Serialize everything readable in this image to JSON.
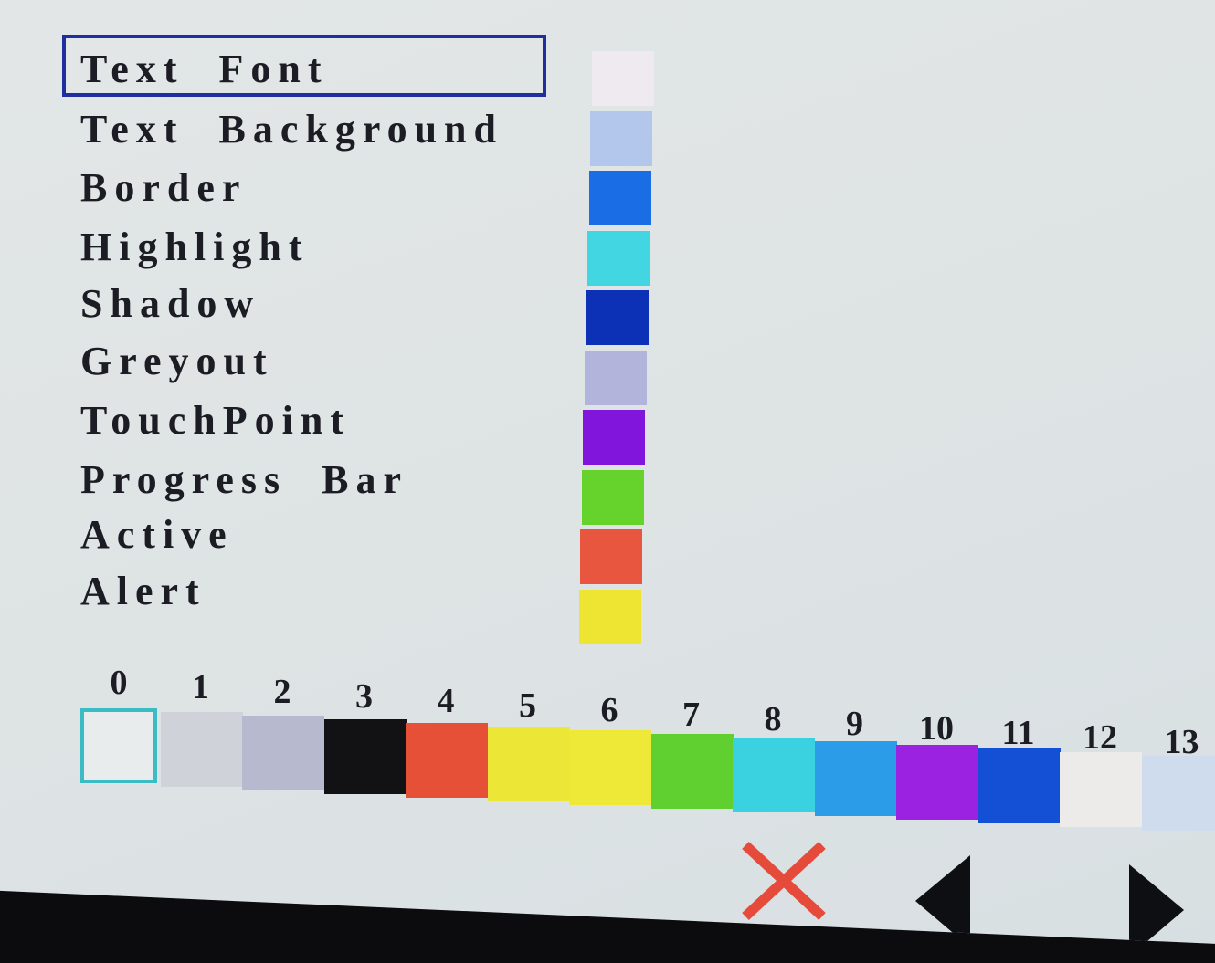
{
  "menu": {
    "items": [
      {
        "label": "Text  Font",
        "selected": true
      },
      {
        "label": "Text  Background",
        "selected": false
      },
      {
        "label": "Border",
        "selected": false
      },
      {
        "label": "Highlight",
        "selected": false
      },
      {
        "label": "Shadow",
        "selected": false
      },
      {
        "label": "Greyout",
        "selected": false
      },
      {
        "label": "TouchPoint",
        "selected": false
      },
      {
        "label": "Progress  Bar",
        "selected": false
      },
      {
        "label": "Active",
        "selected": false
      },
      {
        "label": "Alert",
        "selected": false
      }
    ]
  },
  "assigned_colors": [
    "#eeeaf0",
    "#b3c6ec",
    "#1b6de6",
    "#42d6e2",
    "#0c31b6",
    "#b2b4dc",
    "#8215dc",
    "#66d22c",
    "#e85640",
    "#ede532"
  ],
  "palette": {
    "selected_index": 0,
    "colors": [
      {
        "number": "0",
        "hex": "#e9ecec"
      },
      {
        "number": "1",
        "hex": "#cfd2d8"
      },
      {
        "number": "2",
        "hex": "#b7bace"
      },
      {
        "number": "3",
        "hex": "#121214"
      },
      {
        "number": "4",
        "hex": "#e65036"
      },
      {
        "number": "5",
        "hex": "#ece636"
      },
      {
        "number": "6",
        "hex": "#eee836"
      },
      {
        "number": "7",
        "hex": "#60d030"
      },
      {
        "number": "8",
        "hex": "#3ad2e0"
      },
      {
        "number": "9",
        "hex": "#2a9ce8"
      },
      {
        "number": "10",
        "hex": "#9a22e0"
      },
      {
        "number": "11",
        "hex": "#1450d6"
      },
      {
        "number": "12",
        "hex": "#ecebea"
      },
      {
        "number": "13",
        "hex": "#cfdcee"
      }
    ]
  },
  "controls": {
    "cancel_icon": "close-icon",
    "prev_icon": "arrow-left-icon",
    "next_icon": "arrow-right-icon",
    "cancel_color": "#e64a3a"
  }
}
